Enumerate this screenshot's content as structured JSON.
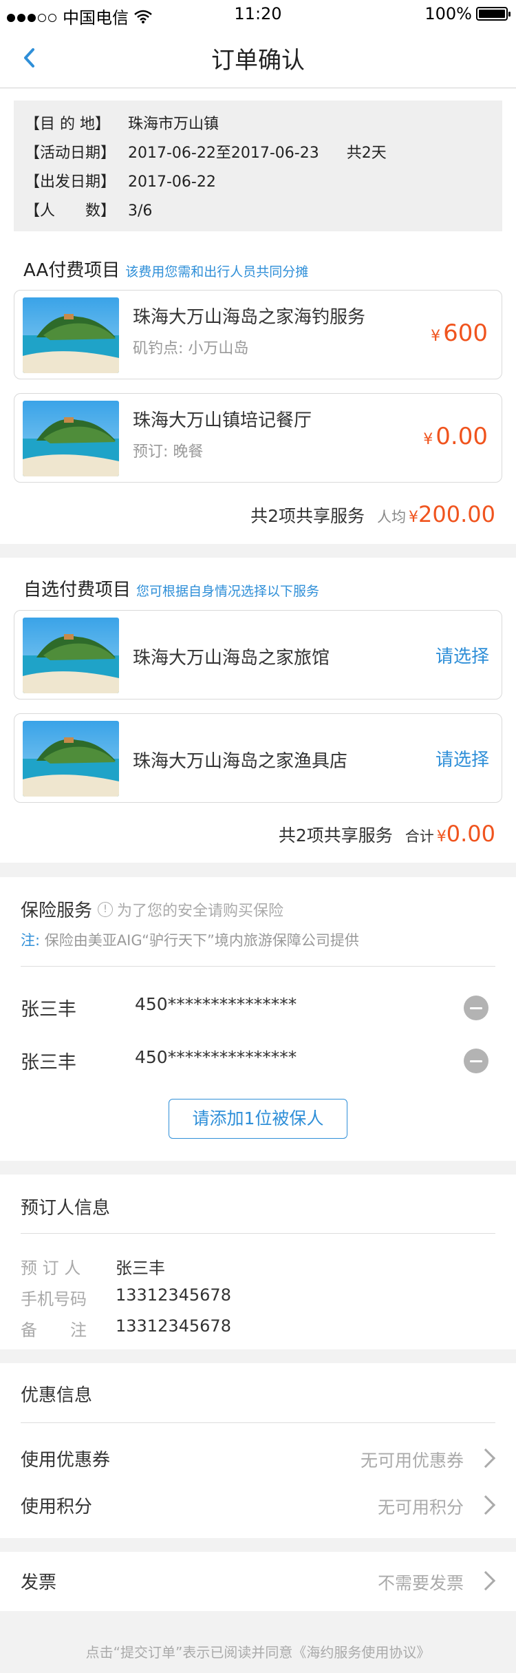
{
  "status_bar": {
    "carrier": "中国电信",
    "time": "11:20",
    "battery": "100%"
  },
  "nav": {
    "title": "订单确认"
  },
  "trip": {
    "rows": [
      {
        "label": "【目 的 地】",
        "value": "珠海市万山镇"
      },
      {
        "label": "【活动日期】",
        "value": "2017-06-22至2017-06-23",
        "extra": "共2天"
      },
      {
        "label": "【出发日期】",
        "value": "2017-06-22"
      },
      {
        "label": "【人　　数】",
        "value": "3/6"
      }
    ]
  },
  "aa": {
    "title": "AA付费项目",
    "note": "该费用您需和出行人员共同分摊",
    "items": [
      {
        "name": "珠海大万山海岛之家海钓服务",
        "sub": "矶钓点:  小万山岛",
        "currency": "¥",
        "price": "600"
      },
      {
        "name": "珠海大万山镇培记餐厅",
        "sub": "预订:  晚餐",
        "currency": "¥",
        "price": "0.00"
      }
    ],
    "summary": {
      "text": "共2项共享服务",
      "label": "人均",
      "currency": "¥",
      "amount": "200.00"
    }
  },
  "optional": {
    "title": "自选付费项目",
    "note": "您可根据自身情况选择以下服务",
    "items": [
      {
        "name": "珠海大万山海岛之家旅馆",
        "action": "请选择"
      },
      {
        "name": "珠海大万山海岛之家渔具店",
        "action": "请选择"
      }
    ],
    "summary": {
      "text": "共2项共享服务",
      "label": "合计",
      "currency": "¥",
      "amount": "0.00"
    }
  },
  "insurance": {
    "title": "保险服务",
    "info_icon": "!",
    "hint": "为了您的安全请购买保险",
    "note_label": "注:",
    "note": "保险由美亚AIG“驴行天下”境内旅游保障公司提供",
    "persons": [
      {
        "name": "张三丰",
        "id": "450***************"
      },
      {
        "name": "张三丰",
        "id": "450***************"
      }
    ],
    "add_label": "请添加1位被保人"
  },
  "booker": {
    "title": "预订人信息",
    "rows": [
      {
        "label": "预 订 人",
        "value": "张三丰"
      },
      {
        "label": "手机号码",
        "value": "13312345678"
      },
      {
        "label": "备　　注",
        "value": "13312345678"
      }
    ]
  },
  "discount": {
    "title": "优惠信息",
    "rows": [
      {
        "label": "使用优惠券",
        "value": "无可用优惠券"
      },
      {
        "label": "使用积分",
        "value": "无可用积分"
      }
    ]
  },
  "invoice": {
    "label": "发票",
    "value": "不需要发票"
  },
  "footer": {
    "text": "点击“提交订单”表示已阅读并同意《海约服务使用协议》"
  },
  "colors": {
    "accent": "#2f8fd8",
    "price": "#f0541e"
  },
  "icons": [
    "back-arrow-icon",
    "wifi-icon",
    "battery-icon",
    "info-icon",
    "minus-circle-icon",
    "chevron-right-icon"
  ]
}
